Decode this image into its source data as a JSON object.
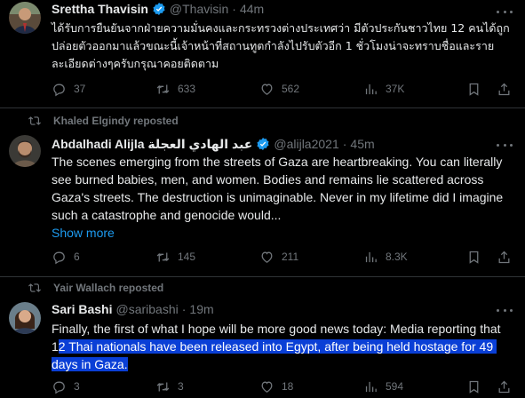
{
  "tweets": [
    {
      "repost_by": "",
      "name": "Srettha Thavisin",
      "handle": "@Thavisin",
      "time": "44m",
      "text": "ได้รับการยืนยันจากฝ่ายความมั่นคงและกระทรวงต่างประเทศว่า มีตัวประกันชาวไทย 12 คนได้ถูกปล่อยตัวออกมาแล้วขณะนี้เจ้าหน้าที่สถานทูตกำลังไปรับตัวอีก 1 ชั่วโมงน่าจะทราบชื่อและรายละเอียดต่างๆครับกรุณาคอยติดตาม",
      "replies": "37",
      "reposts": "633",
      "likes": "562",
      "views": "37K",
      "avatar_icon": "person-avatar"
    },
    {
      "repost_by": "Khaled Elgindy reposted",
      "name": "Abdalhadi Alijla عبد الهادي العجلة",
      "handle": "@alijla2021",
      "time": "45m",
      "text": "The scenes emerging from the streets of Gaza are heartbreaking. You can literally see burned babies, men, and women. Bodies and remains lie scattered across Gaza's streets. The destruction is unimaginable. Never in my lifetime did I imagine such a catastrophe and genocide would...",
      "show_more": "Show more",
      "replies": "6",
      "reposts": "145",
      "likes": "211",
      "views": "8.3K",
      "avatar_icon": "person-avatar"
    },
    {
      "repost_by": "Yair Wallach reposted",
      "name": "Sari Bashi",
      "handle": "@saribashi",
      "time": "19m",
      "text_before": "Finally, the first of what I hope will be more good news today: Media reporting that 1",
      "text_highlight": "2 Thai nationals have been released into Egypt, after being held hostage for 49 days in Gaza.",
      "replies": "3",
      "reposts": "3",
      "likes": "18",
      "views": "594",
      "avatar_icon": "person-avatar"
    }
  ],
  "dot": "·",
  "colors": {
    "background": "#000000",
    "text": "#e7e9ea",
    "muted": "#71767b",
    "link": "#1d9bf0",
    "verified": "#1d9bf0",
    "selection": "#0a3fd6",
    "divider": "#2f3336"
  }
}
